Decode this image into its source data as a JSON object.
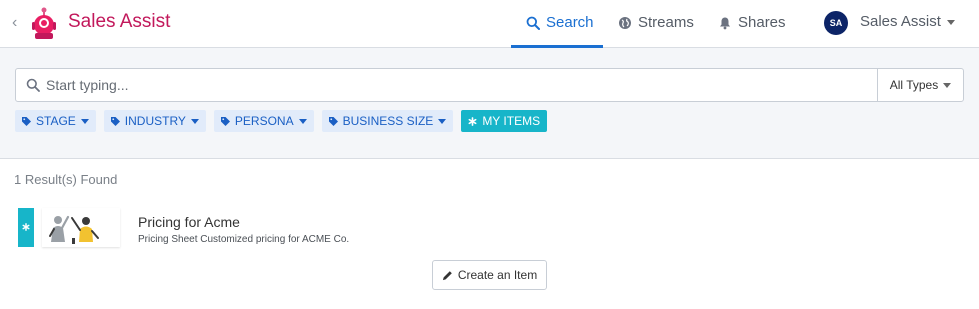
{
  "header": {
    "app_title": "Sales Assist",
    "back_icon": "chevron-left-icon",
    "logo_icon": "robot-logo-icon",
    "nav": [
      {
        "label": "Search",
        "icon": "search-icon",
        "active": true
      },
      {
        "label": "Streams",
        "icon": "globe-icon",
        "active": false
      },
      {
        "label": "Shares",
        "icon": "bell-icon",
        "active": false
      }
    ],
    "user": {
      "initials": "SA",
      "name": "Sales Assist"
    },
    "colors": {
      "brand": "#c2185b",
      "accent": "#1a6fd1"
    }
  },
  "search": {
    "placeholder": "Start typing...",
    "value": "",
    "type_select": "All Types"
  },
  "filters": [
    {
      "label": "STAGE",
      "icon": "tag-icon",
      "dropdown": true
    },
    {
      "label": "INDUSTRY",
      "icon": "tag-icon",
      "dropdown": true
    },
    {
      "label": "PERSONA",
      "icon": "tag-icon",
      "dropdown": true
    },
    {
      "label": "BUSINESS SIZE",
      "icon": "tag-icon",
      "dropdown": true
    },
    {
      "label": "MY ITEMS",
      "icon": "asterisk-icon",
      "dropdown": false,
      "active": true
    }
  ],
  "results": {
    "count_text": "1 Result(s) Found",
    "items": [
      {
        "title": "Pricing for Acme",
        "description": "Pricing Sheet Customized pricing for ACME Co.",
        "accent_color": "#17b5c9"
      }
    ]
  },
  "actions": {
    "create_label": "Create an Item",
    "create_icon": "pencil-icon"
  }
}
